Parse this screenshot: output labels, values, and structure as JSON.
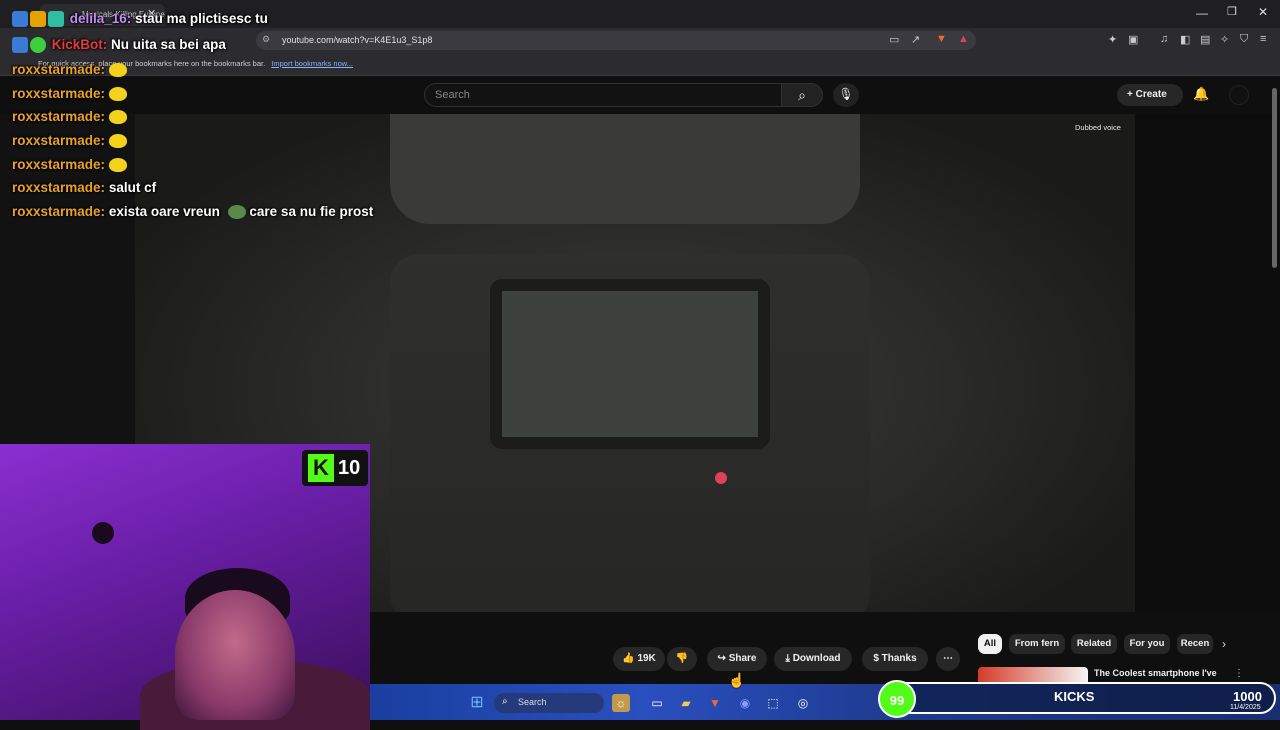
{
  "browser": {
    "tab_title": "Musicals Killing Europe",
    "url": "youtube.com/watch?v=K4E1u3_S1p8",
    "bookmarks_hint": "For quick access, place your bookmarks here on the bookmarks bar.",
    "import_link": "Import bookmarks now..."
  },
  "youtube": {
    "search_placeholder": "Search",
    "create_label": "Create",
    "dubbed_label": "Dubbed voice",
    "actions": {
      "likes": "19K",
      "share": "Share",
      "download": "Download",
      "thanks": "Thanks"
    },
    "chips": [
      "All",
      "From fern",
      "Related",
      "For you",
      "Recen"
    ],
    "recommended_title": "The Coolest smartphone I've ever held - (Not Clickbait)"
  },
  "chat": [
    {
      "user": "delila_16:",
      "message": "stau ma plictisesc tu",
      "user_color": "#c28cf2"
    },
    {
      "user": "KickBot:",
      "message": "Nu uita sa bei apa",
      "user_color": "#e23b3b"
    },
    {
      "user": "roxxstarmade:",
      "message": ""
    },
    {
      "user": "roxxstarmade:",
      "message": ""
    },
    {
      "user": "roxxstarmade:",
      "message": ""
    },
    {
      "user": "roxxstarmade:",
      "message": ""
    },
    {
      "user": "roxxstarmade:",
      "message": ""
    },
    {
      "user": "roxxstarmade:",
      "message": "salut cf"
    },
    {
      "user": "roxxstarmade:",
      "message": "exista oare vreun",
      "message2": "care sa nu fie prost"
    }
  ],
  "stream": {
    "viewer_count": "10",
    "kicks_goal_current": "99",
    "kicks_label": "KICKS",
    "kicks_goal_total": "1000"
  },
  "taskbar": {
    "search_label": "Search",
    "date": "11/4/2025"
  }
}
